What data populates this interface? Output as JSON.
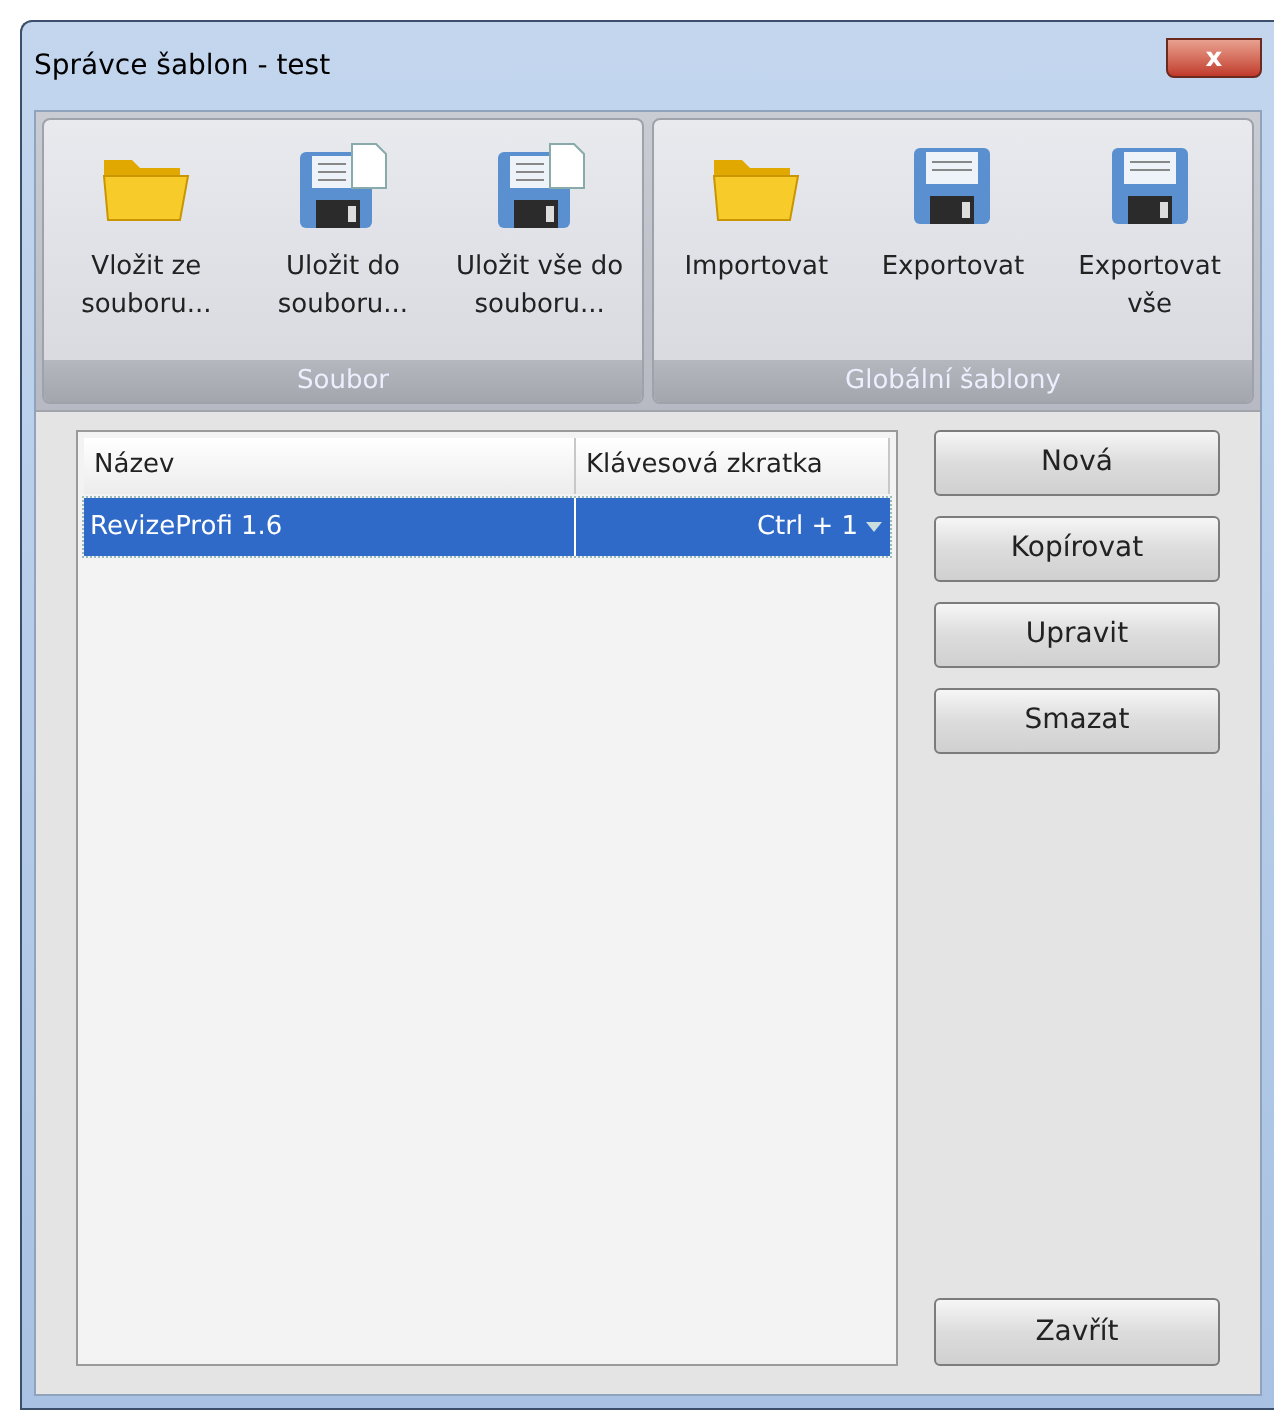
{
  "window": {
    "title": "Správce šablon - test",
    "close": "x"
  },
  "ribbon": {
    "groups": [
      {
        "label": "Soubor",
        "items": [
          {
            "kind": "folder",
            "label": "Vložit ze souboru..."
          },
          {
            "kind": "save-doc",
            "label": "Uložit do souboru..."
          },
          {
            "kind": "save-doc",
            "label": "Uložit vše do souboru..."
          }
        ]
      },
      {
        "label": "Globální šablony",
        "items": [
          {
            "kind": "folder",
            "label": "Importovat"
          },
          {
            "kind": "save",
            "label": "Exportovat"
          },
          {
            "kind": "save",
            "label": "Exportovat vše"
          }
        ]
      }
    ]
  },
  "table": {
    "columns": [
      "Název",
      "Klávesová zkratka"
    ],
    "rows": [
      {
        "name": "RevizeProfi 1.6",
        "shortcut": "Ctrl + 1",
        "selected": true
      }
    ]
  },
  "buttons": [
    "Nová",
    "Kopírovat",
    "Upravit",
    "Smazat"
  ],
  "close_button": "Zavřít"
}
